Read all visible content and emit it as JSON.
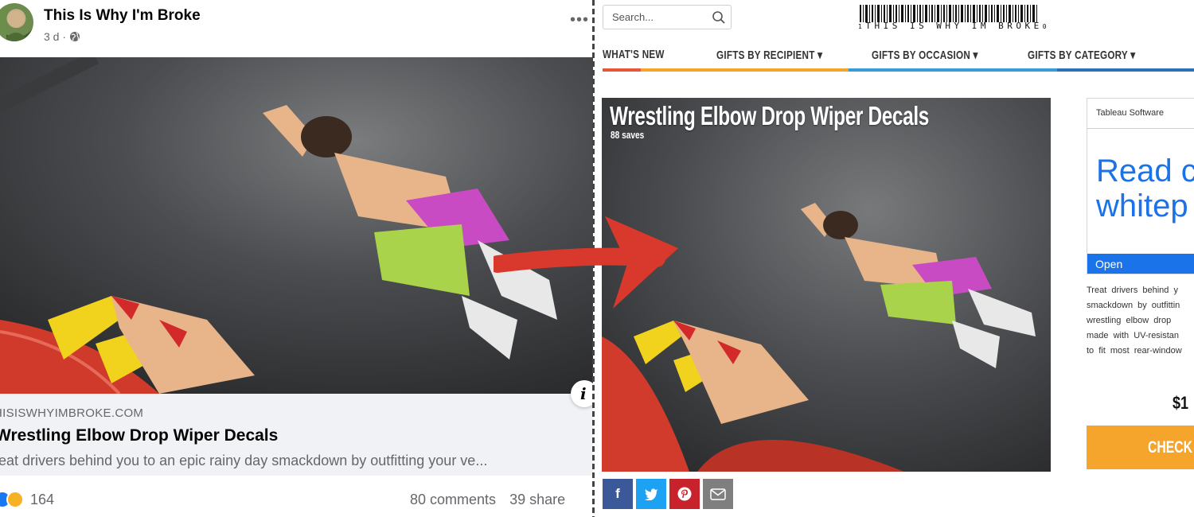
{
  "facebook_post": {
    "page_name": "This Is Why I'm Broke",
    "time": "3 d ·",
    "more_icon": "more-horizontal-icon",
    "link_domain": "HISISWHYIMBROKE.COM",
    "link_title": "Wrestling Elbow Drop Wiper Decals",
    "link_description": "reat drivers behind you to an epic rainy day smackdown by outfitting your ve...",
    "info_icon": "info-icon",
    "reaction_count": "164",
    "comments": "80 comments",
    "shares": "39 share"
  },
  "site": {
    "search_placeholder": "Search...",
    "logo_text": "THIS IS WHY IM BROKE",
    "logo_left_mark": "1",
    "logo_right_mark": "0",
    "nav": [
      {
        "label": "WHAT'S NEW",
        "bar_color": "#e8563a"
      },
      {
        "label": "GIFTS BY RECIPIENT ▾",
        "bar_color": "#f5a42c"
      },
      {
        "label": "GIFTS BY OCCASION ▾",
        "bar_color": "#3a9bd9"
      },
      {
        "label": "GIFTS BY CATEGORY ▾",
        "bar_color": "#2f6fb8"
      }
    ],
    "product": {
      "title": "Wrestling Elbow Drop Wiper Decals",
      "saves": "88 saves",
      "price": "$1",
      "checkout_label": "CHECK"
    },
    "share_buttons": [
      {
        "name": "facebook",
        "glyph": "f",
        "color": "#3b5998"
      },
      {
        "name": "twitter",
        "glyph": "t",
        "color": "#1da1f2"
      },
      {
        "name": "pinterest",
        "glyph": "p",
        "color": "#c8232c"
      },
      {
        "name": "email",
        "glyph": "✉",
        "color": "#7f7f7f"
      }
    ],
    "ad": {
      "sponsor": "Tableau Software",
      "headline_1": "Read c",
      "headline_2": "whitep",
      "open_label": "Open"
    },
    "description_lines": [
      "Treat drivers behind y",
      "smackdown by outfittin",
      "wrestling elbow drop",
      "made with UV-resistan",
      "to fit most rear-window"
    ]
  },
  "colors": {
    "arrow": "#d9382c",
    "checkout": "#f5a42c",
    "ad_blue": "#1a73e8",
    "fb_link_bg": "#f0f2f5"
  }
}
